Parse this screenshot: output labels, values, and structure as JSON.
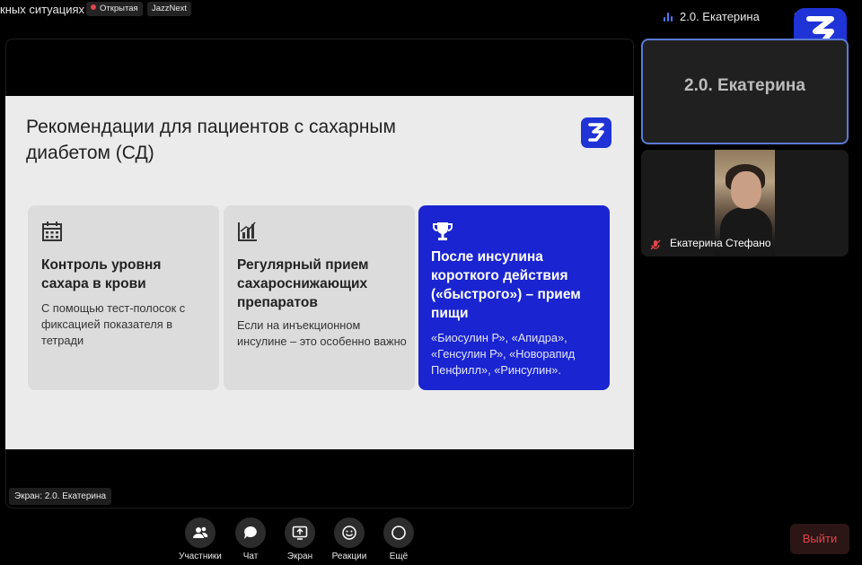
{
  "meeting": {
    "title": "кных ситуациях",
    "tag_open": "Открытая",
    "tag_jazz": "JazzNext",
    "active_speaker": "2.0. Екатерина",
    "top_partial": "2"
  },
  "slide": {
    "title": "Рекомендации для пациентов с сахарным диабетом (СД)",
    "cards": [
      {
        "icon": "calendar-icon",
        "title": "Контроль уровня сахара в крови",
        "body": "С помощью тест-полосок с фиксацией показателя в тетради"
      },
      {
        "icon": "bar-chart-icon",
        "title": "Регулярный прием сахароснижающих препаратов",
        "body": "Если на инъекционном инсулине – это особенно важно"
      },
      {
        "icon": "trophy-icon",
        "title": "После инсулина короткого действия («быстрого») – прием пищи",
        "body": "«Биосулин Р», «Апидра», «Генсулин Р», «Новорапид Пенфилл», «Ринсулин»."
      }
    ]
  },
  "screen_caption": "Экран: 2.0. Екатерина",
  "participants": {
    "active_tile_name": "2.0. Екатерина",
    "video_name": "Екатерина Стефано"
  },
  "controls": {
    "participants": "Участники",
    "chat": "Чат",
    "screen": "Экран",
    "reactions": "Реакции",
    "more": "Ещё",
    "leave": "Выйти"
  },
  "colors": {
    "brand": "#1f33d6",
    "highlight_card": "#1a24d0",
    "leave": "#e0464b",
    "active_border": "#5b7bd6"
  }
}
